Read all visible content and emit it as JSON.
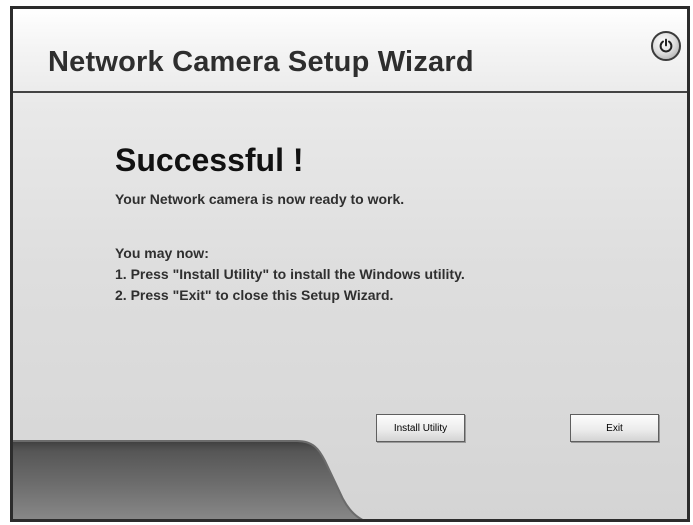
{
  "window": {
    "title": "Network Camera Setup Wizard",
    "power_icon": "power-icon"
  },
  "content": {
    "heading": "Successful !",
    "ready_text": "Your Network camera is now ready to work.",
    "intro": "You may now:",
    "steps": [
      "1. Press \"Install Utility\" to install the Windows utility.",
      "2. Press \"Exit\" to close this Setup Wizard."
    ]
  },
  "buttons": {
    "install_utility": "Install Utility",
    "exit": "Exit"
  },
  "colors": {
    "footer_dark": "#555555",
    "footer_light": "#8a8a8a",
    "border": "#2c2c2c"
  }
}
